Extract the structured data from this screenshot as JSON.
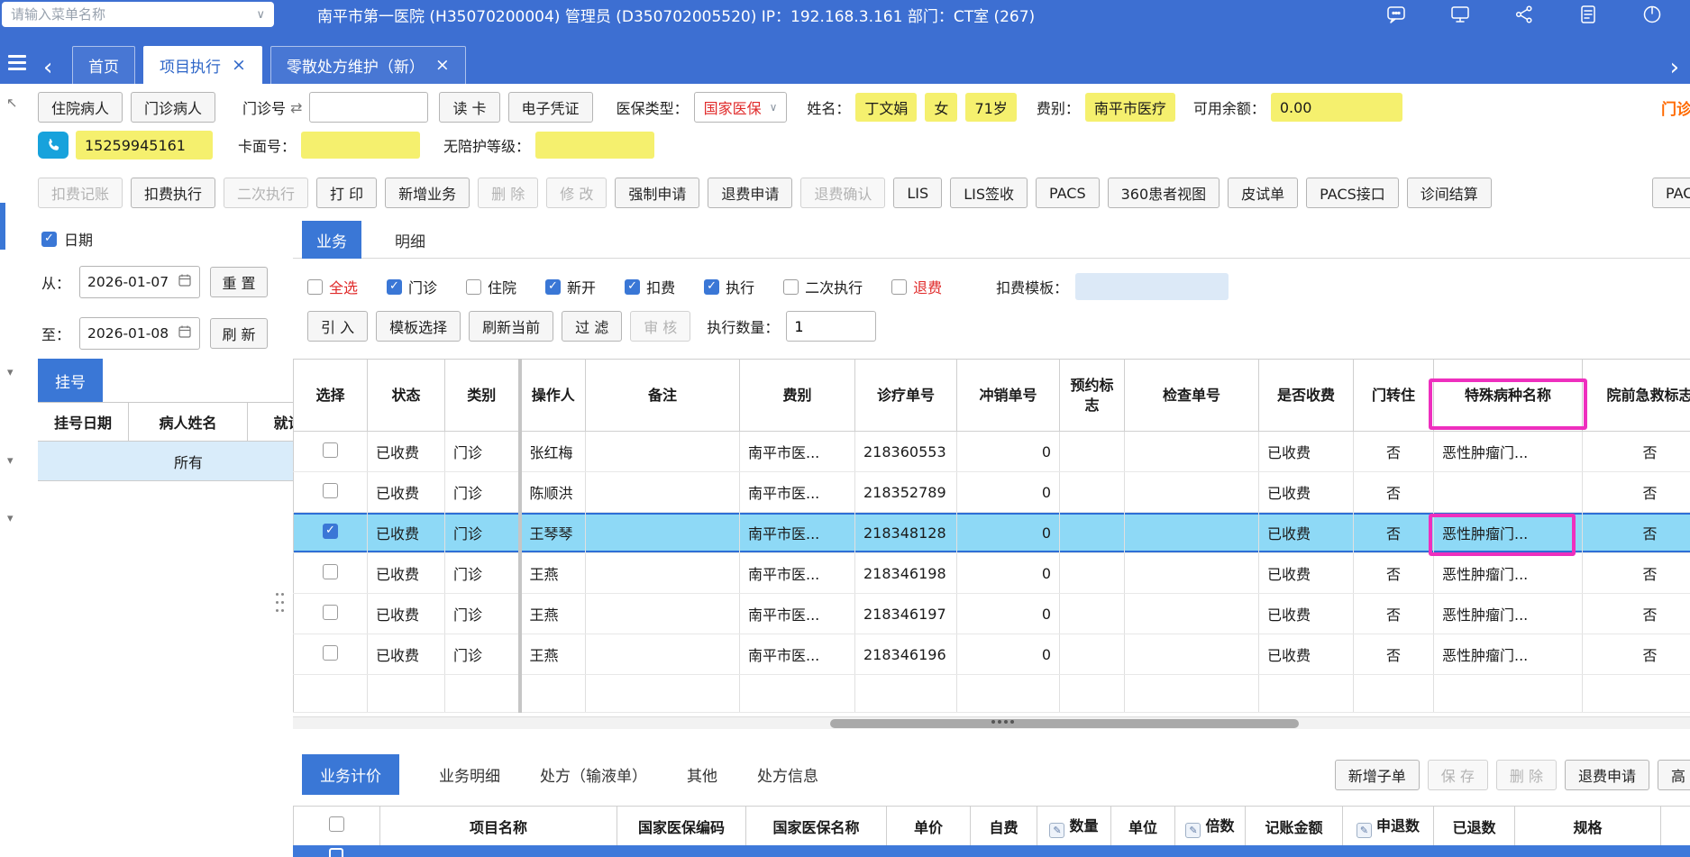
{
  "colors": {
    "topbar_blue": "#3d6fd2",
    "accent_blue": "#3a77d6",
    "selected_row_cyan": "#8ed9f6",
    "field_yellow": "#f5f06e",
    "alert_red": "#e02a2a",
    "clipped_orange": "#ff6a00",
    "annotation_magenta": "#ee2fbe"
  },
  "topbar": {
    "menu_search_placeholder": "请输入菜单名称",
    "session_info": "南平市第一医院 (H35070200004) 管理员 (D350702005520) IP：192.168.3.161 部门：CT室 (267)",
    "icons": [
      "chat-icon",
      "monitor-icon",
      "share-icon",
      "document-icon",
      "power-icon"
    ]
  },
  "tabbar": {
    "tabs": [
      {
        "label": "首页",
        "closable": false,
        "active": false
      },
      {
        "label": "项目执行",
        "closable": true,
        "active": true
      },
      {
        "label": "零散处方维护（新）",
        "closable": true,
        "active": false
      }
    ]
  },
  "patient": {
    "inpatient_button": "住院病人",
    "outpatient_button": "门诊病人",
    "outpatient_no_label": "门诊号",
    "outpatient_no_value": "",
    "read_card_button": "读 卡",
    "e_voucher_button": "电子凭证",
    "insurance_label": "医保类型：",
    "insurance_value": "国家医保",
    "name_label": "姓名：",
    "name_value": "丁文娟",
    "gender_value": "女",
    "age_value": "71岁",
    "fee_label": "费别：",
    "fee_value": "南平市医疗",
    "balance_label": "可用余额：",
    "balance_value": "0.00",
    "clipped_right_text": "门诊",
    "phone_value": "15259945161",
    "card_label": "卡面号：",
    "card_value": "",
    "care_label": "无陪护等级：",
    "care_value": ""
  },
  "toolbar": {
    "buttons": [
      {
        "label": "扣费记账",
        "enabled": false
      },
      {
        "label": "扣费执行",
        "enabled": true
      },
      {
        "label": "二次执行",
        "enabled": false
      },
      {
        "label": "打 印",
        "enabled": true
      },
      {
        "label": "新增业务",
        "enabled": true
      },
      {
        "label": "删 除",
        "enabled": false
      },
      {
        "label": "修 改",
        "enabled": false
      },
      {
        "label": "强制申请",
        "enabled": true
      },
      {
        "label": "退费申请",
        "enabled": true
      },
      {
        "label": "退费确认",
        "enabled": false
      },
      {
        "label": "LIS",
        "enabled": true
      },
      {
        "label": "LIS签收",
        "enabled": true
      },
      {
        "label": "PACS",
        "enabled": true
      },
      {
        "label": "360患者视图",
        "enabled": true
      },
      {
        "label": "皮试单",
        "enabled": true
      },
      {
        "label": "PACS接口",
        "enabled": true
      },
      {
        "label": "诊间结算",
        "enabled": true
      },
      {
        "label": "PAC",
        "enabled": true,
        "clipped": true
      }
    ]
  },
  "left_panel": {
    "date_filter_label": "日期",
    "date_filter_checked": true,
    "from_label": "从：",
    "from_value": "2026-01-07",
    "reset_button": "重 置",
    "to_label": "至：",
    "to_value": "2026-01-08",
    "refresh_button": "刷 新",
    "register_tab": "挂号",
    "table_headers": [
      "挂号日期",
      "病人姓名",
      "就诊"
    ],
    "table_row_value": "所有"
  },
  "main": {
    "tabs": [
      {
        "label": "业务",
        "active": true
      },
      {
        "label": "明细",
        "active": false
      }
    ],
    "filters": [
      {
        "label": "全选",
        "checked": false,
        "red": true
      },
      {
        "label": "门诊",
        "checked": true
      },
      {
        "label": "住院",
        "checked": false
      },
      {
        "label": "新开",
        "checked": true
      },
      {
        "label": "扣费",
        "checked": true
      },
      {
        "label": "执行",
        "checked": true
      },
      {
        "label": "二次执行",
        "checked": false
      },
      {
        "label": "退费",
        "checked": false,
        "red": true
      }
    ],
    "template_label": "扣费模板：",
    "template_value": "",
    "action_buttons": [
      {
        "label": "引 入",
        "enabled": true
      },
      {
        "label": "模板选择",
        "enabled": true
      },
      {
        "label": "刷新当前",
        "enabled": true
      },
      {
        "label": "过 滤",
        "enabled": true
      },
      {
        "label": "审 核",
        "enabled": false
      }
    ],
    "exec_count_label": "执行数量：",
    "exec_count_value": "1",
    "grid": {
      "headers": [
        "选择",
        "状态",
        "类别",
        "操作人",
        "备注",
        "费别",
        "诊疗单号",
        "冲销单号",
        "预约标志",
        "检查单号",
        "是否收费",
        "门转住",
        "特殊病种名称",
        "院前急救标志"
      ],
      "rows": [
        {
          "checked": false,
          "selected": false,
          "status": "已收费",
          "category": "门诊",
          "operator": "张红梅",
          "note": "",
          "fee_type": "南平市医...",
          "clinic_no": "218360553",
          "offset_no": "0",
          "appt_flag": "",
          "exam_no": "",
          "charge_status": "已收费",
          "door_transfer": "否",
          "special_disease": "恶性肿瘤门...",
          "pre_rescue": "否"
        },
        {
          "checked": false,
          "selected": false,
          "status": "已收费",
          "category": "门诊",
          "operator": "陈顺洪",
          "note": "",
          "fee_type": "南平市医...",
          "clinic_no": "218352789",
          "offset_no": "0",
          "appt_flag": "",
          "exam_no": "",
          "charge_status": "已收费",
          "door_transfer": "否",
          "special_disease": "",
          "pre_rescue": "否"
        },
        {
          "checked": true,
          "selected": true,
          "status": "已收费",
          "category": "门诊",
          "operator": "王琴琴",
          "note": "",
          "fee_type": "南平市医...",
          "clinic_no": "218348128",
          "offset_no": "0",
          "appt_flag": "",
          "exam_no": "",
          "charge_status": "已收费",
          "door_transfer": "否",
          "special_disease": "恶性肿瘤门...",
          "pre_rescue": "否"
        },
        {
          "checked": false,
          "selected": false,
          "status": "已收费",
          "category": "门诊",
          "operator": "王燕",
          "note": "",
          "fee_type": "南平市医...",
          "clinic_no": "218346198",
          "offset_no": "0",
          "appt_flag": "",
          "exam_no": "",
          "charge_status": "已收费",
          "door_transfer": "否",
          "special_disease": "恶性肿瘤门...",
          "pre_rescue": "否"
        },
        {
          "checked": false,
          "selected": false,
          "status": "已收费",
          "category": "门诊",
          "operator": "王燕",
          "note": "",
          "fee_type": "南平市医...",
          "clinic_no": "218346197",
          "offset_no": "0",
          "appt_flag": "",
          "exam_no": "",
          "charge_status": "已收费",
          "door_transfer": "否",
          "special_disease": "恶性肿瘤门...",
          "pre_rescue": "否"
        },
        {
          "checked": false,
          "selected": false,
          "status": "已收费",
          "category": "门诊",
          "operator": "王燕",
          "note": "",
          "fee_type": "南平市医...",
          "clinic_no": "218346196",
          "offset_no": "0",
          "appt_flag": "",
          "exam_no": "",
          "charge_status": "已收费",
          "door_transfer": "否",
          "special_disease": "恶性肿瘤门...",
          "pre_rescue": "否"
        }
      ]
    }
  },
  "bottom": {
    "tabs": [
      {
        "label": "业务计价",
        "active": true
      },
      {
        "label": "业务明细",
        "active": false
      },
      {
        "label": "处方（输液单）",
        "active": false
      },
      {
        "label": "其他",
        "active": false
      },
      {
        "label": "处方信息",
        "active": false
      }
    ],
    "buttons": [
      {
        "label": "新增子单",
        "enabled": true
      },
      {
        "label": "保 存",
        "enabled": false
      },
      {
        "label": "删 除",
        "enabled": false
      },
      {
        "label": "退费申请",
        "enabled": true
      },
      {
        "label": "高",
        "enabled": true,
        "clipped": true
      }
    ],
    "columns": [
      {
        "label": "项目名称"
      },
      {
        "label": "国家医保编码"
      },
      {
        "label": "国家医保名称"
      },
      {
        "label": "单价"
      },
      {
        "label": "自费"
      },
      {
        "label": "数量",
        "editable": true
      },
      {
        "label": "单位"
      },
      {
        "label": "倍数",
        "editable": true
      },
      {
        "label": "记账金额"
      },
      {
        "label": "申退数",
        "editable": true
      },
      {
        "label": "已退数"
      },
      {
        "label": "规格"
      }
    ]
  },
  "annotations": {
    "color": "#ee2fbe",
    "boxes": [
      "special-disease-header-highlight",
      "special-disease-cell-highlight"
    ]
  }
}
